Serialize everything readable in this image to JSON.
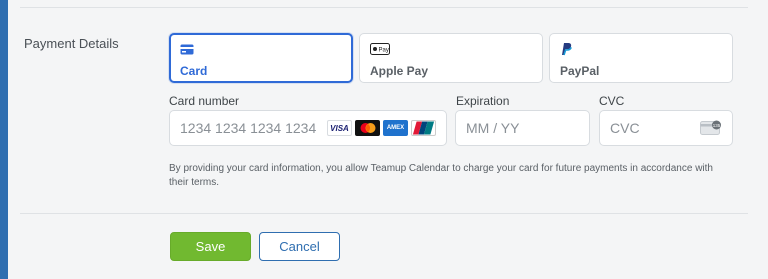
{
  "section": {
    "label": "Payment Details"
  },
  "tabs": [
    {
      "label": "Card",
      "icon": "card-icon",
      "selected": true
    },
    {
      "label": "Apple Pay",
      "icon": "apple-pay-icon",
      "selected": false
    },
    {
      "label": "PayPal",
      "icon": "paypal-icon",
      "selected": false
    }
  ],
  "apple_pay_mark": "Pay",
  "fields": {
    "card_number": {
      "label": "Card number",
      "placeholder": "1234 1234 1234 1234"
    },
    "expiration": {
      "label": "Expiration",
      "placeholder": "MM / YY"
    },
    "cvc": {
      "label": "CVC",
      "placeholder": "CVC"
    }
  },
  "brands": [
    {
      "name": "visa",
      "mark": "VISA"
    },
    {
      "name": "mastercard"
    },
    {
      "name": "amex",
      "mark": "AMEX"
    },
    {
      "name": "unionpay"
    }
  ],
  "cvc_icon_text": "135",
  "legal_text": "By providing your card information, you allow Teamup Calendar to charge your card for future payments in accordance with their terms.",
  "buttons": {
    "save": "Save",
    "cancel": "Cancel"
  },
  "colors": {
    "accent": "#2f6ad7",
    "save_green": "#71b930",
    "rail_blue": "#2f6eb0",
    "background": "#f4f5f6"
  }
}
